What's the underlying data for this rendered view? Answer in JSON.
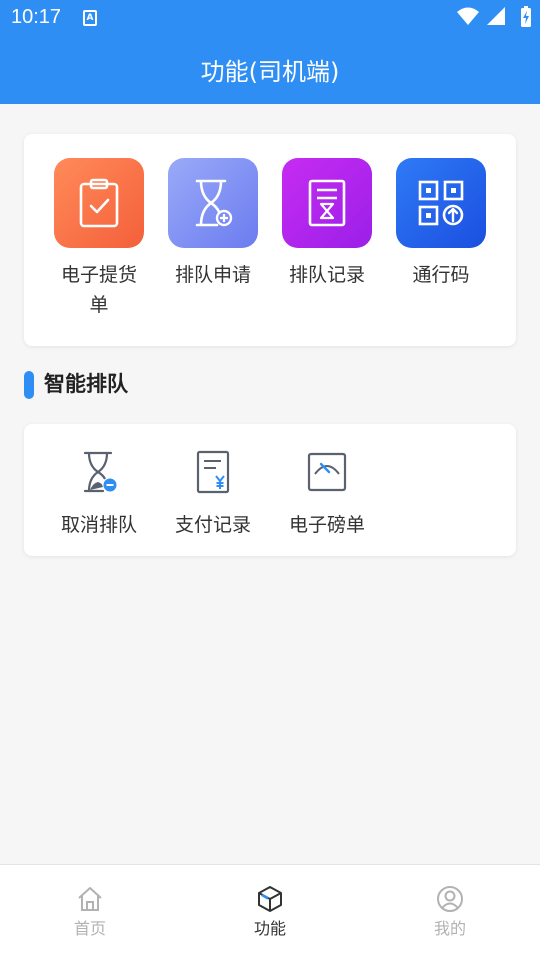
{
  "status_bar": {
    "time": "10:17",
    "notification_icon": "A"
  },
  "header": {
    "title": "功能(司机端)"
  },
  "features": [
    {
      "label": "电子提货单",
      "icon": "clipboard-check-icon",
      "color_from": "#ff8a5a",
      "color_to": "#f4603a"
    },
    {
      "label": "排队申请",
      "icon": "hourglass-plus-icon",
      "color_from": "#8fa0f6",
      "color_to": "#6b7cf0"
    },
    {
      "label": "排队记录",
      "icon": "document-hourglass-icon",
      "color_from": "#c72cf2",
      "color_to": "#9b1fe8"
    },
    {
      "label": "通行码",
      "icon": "qrcode-upload-icon",
      "color_from": "#2f73f5",
      "color_to": "#1b4fe0"
    }
  ],
  "section": {
    "title": "智能排队",
    "accent": "#2e8ef4"
  },
  "queue_actions": [
    {
      "label": "取消排队",
      "icon": "hourglass-minus-icon"
    },
    {
      "label": "支付记录",
      "icon": "receipt-yuan-icon"
    },
    {
      "label": "电子磅单",
      "icon": "gauge-icon"
    }
  ],
  "tabs": [
    {
      "label": "首页",
      "icon": "home-icon",
      "active": false
    },
    {
      "label": "功能",
      "icon": "cube-icon",
      "active": true
    },
    {
      "label": "我的",
      "icon": "user-icon",
      "active": false
    }
  ]
}
